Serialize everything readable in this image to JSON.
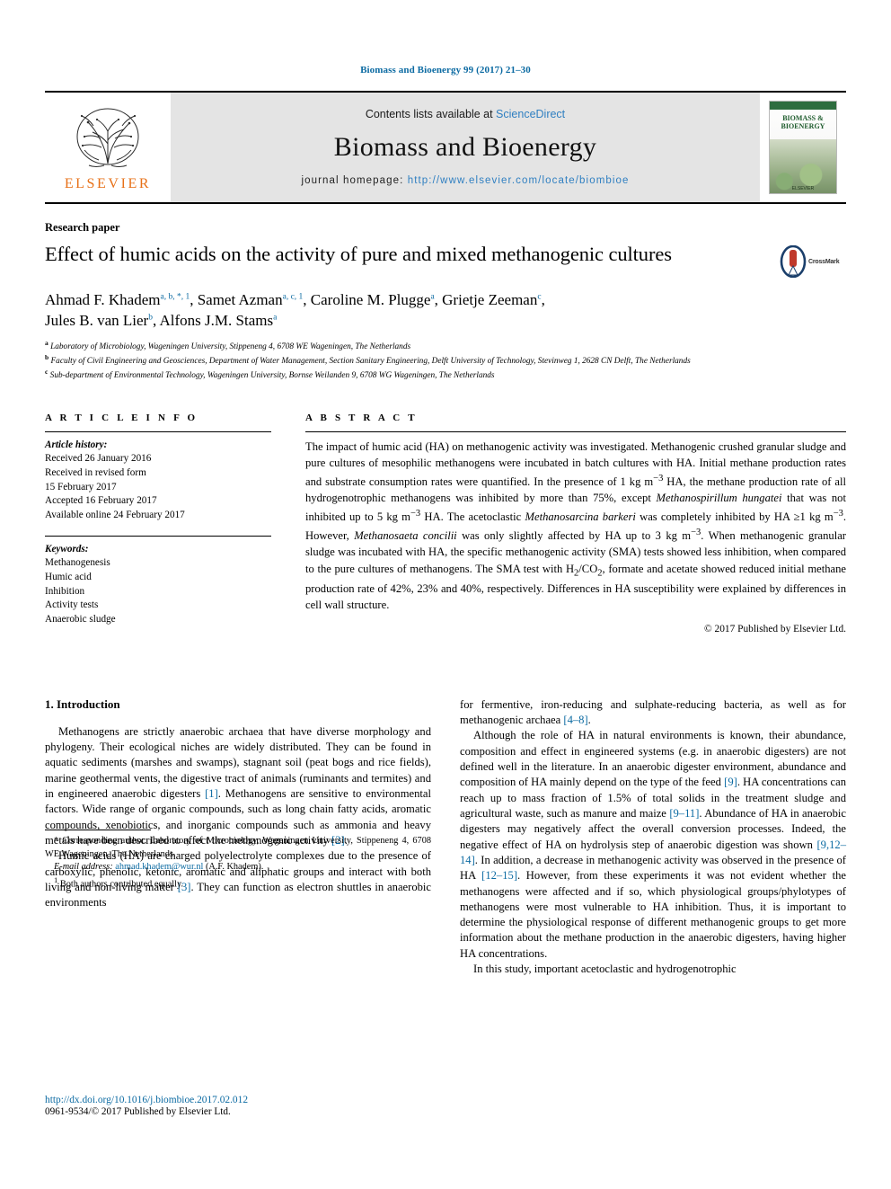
{
  "running_head": "Biomass and Bioenergy 99 (2017) 21–30",
  "masthead": {
    "publisher_name": "ELSEVIER",
    "contents_prefix": "Contents lists available at ",
    "contents_link": "ScienceDirect",
    "journal_title": "Biomass and Bioenergy",
    "homepage_prefix": "journal homepage: ",
    "homepage_url": "http://www.elsevier.com/locate/biombioe",
    "cover_title": "BIOMASS & BIOENERGY",
    "cover_sub": "ELSEVIER"
  },
  "article": {
    "kind": "Research paper",
    "title": "Effect of humic acids on the activity of pure and mixed methanogenic cultures",
    "crossmark_label": "CrossMark",
    "authors_line1": "Ahmad F. Khadem",
    "authors_sup1": "a, b, *, 1",
    "authors_line2": ", Samet Azman",
    "authors_sup2": "a, c, 1",
    "authors_line3": ", Caroline M. Plugge",
    "authors_sup3": "a",
    "authors_line4": ", Grietje Zeeman",
    "authors_sup4": "c",
    "authors_line5": ",",
    "authors_line6": "Jules B. van Lier",
    "authors_sup6": "b",
    "authors_line7": ", Alfons J.M. Stams",
    "authors_sup7": "a",
    "affiliations": [
      {
        "mark": "a",
        "text": "Laboratory of Microbiology, Wageningen University, Stippeneng 4, 6708 WE Wageningen, The Netherlands"
      },
      {
        "mark": "b",
        "text": "Faculty of Civil Engineering and Geosciences, Department of Water Management, Section Sanitary Engineering, Delft University of Technology, Stevinweg 1, 2628 CN Delft, The Netherlands"
      },
      {
        "mark": "c",
        "text": "Sub-department of Environmental Technology, Wageningen University, Bornse Weilanden 9, 6708 WG Wageningen, The Netherlands"
      }
    ]
  },
  "article_info": {
    "heading": "A R T I C L E  I N F O",
    "history_label": "Article history:",
    "history": [
      "Received 26 January 2016",
      "Received in revised form",
      "15 February 2017",
      "Accepted 16 February 2017",
      "Available online 24 February 2017"
    ],
    "keywords_label": "Keywords:",
    "keywords": [
      "Methanogenesis",
      "Humic acid",
      "Inhibition",
      "Activity tests",
      "Anaerobic sludge"
    ]
  },
  "abstract": {
    "heading": "A B S T R A C T",
    "copyright": "© 2017 Published by Elsevier Ltd."
  },
  "introduction": {
    "heading": "1.  Introduction"
  },
  "footnotes": {
    "corresponding": "* Corresponding author. Laboratory of Microbiology, Wageningen University, Stippeneng 4, 6708 WE Wageningen, The Netherlands.",
    "email_label": "E-mail address:",
    "email": "ahmad.khadem@wur.nl",
    "email_attr": "(A.F. Khadem).",
    "equal_mark": "1",
    "equal": "Both authors contributed equally."
  },
  "footer": {
    "doi": "http://dx.doi.org/10.1016/j.biombioe.2017.02.012",
    "issn": "0961-9534/© 2017 Published by Elsevier Ltd."
  },
  "colors": {
    "link": "#0b6aa2",
    "elsevier_orange": "#e77017",
    "masthead_bg": "#e4e4e4"
  }
}
